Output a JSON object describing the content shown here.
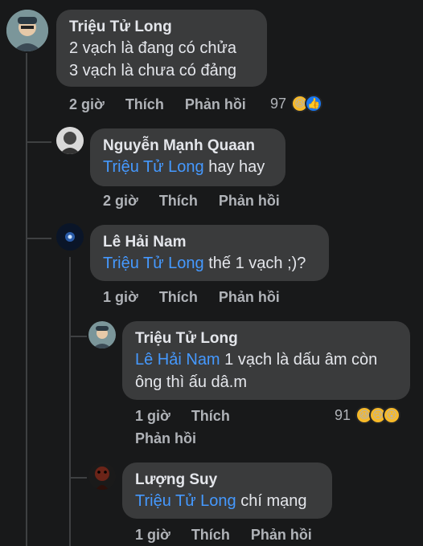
{
  "comments": [
    {
      "author": "Triệu Tử Long",
      "lines": [
        "2 vạch là đang có chửa",
        "3 vạch là chưa có đảng"
      ],
      "time": "2 giờ",
      "like": "Thích",
      "reply": "Phản hồi",
      "reaction_count": "97",
      "reactions": [
        "haha-icon",
        "like-icon"
      ]
    },
    {
      "author": "Nguyễn Mạnh Quaan",
      "mention": "Triệu Tử Long",
      "text": " hay hay",
      "time": "2 giờ",
      "like": "Thích",
      "reply": "Phản hồi"
    },
    {
      "author": "Lê Hải Nam",
      "mention": "Triệu Tử Long",
      "text": " thế 1 vạch ;)?",
      "time": "1 giờ",
      "like": "Thích",
      "reply": "Phản hồi"
    },
    {
      "author": "Triệu Tử Long",
      "mention": "Lê Hải Nam",
      "text": " 1 vạch là dấu âm còn",
      "text2": "ông thì ấu dâ.m",
      "time": "1 giờ",
      "like": "Thích",
      "reply": "Phản hồi",
      "reaction_count": "91",
      "reactions": [
        "haha-icon",
        "sad-icon",
        "wow-icon"
      ]
    },
    {
      "author": "Lượng Suy",
      "mention": "Triệu Tử Long",
      "text": " chí mạng",
      "time": "1 giờ",
      "like": "Thích",
      "reply": "Phản hồi"
    }
  ],
  "colors": {
    "background": "#18191a",
    "bubble": "#3a3b3c",
    "mention": "#4599ff",
    "muted": "#b0b3b8"
  }
}
